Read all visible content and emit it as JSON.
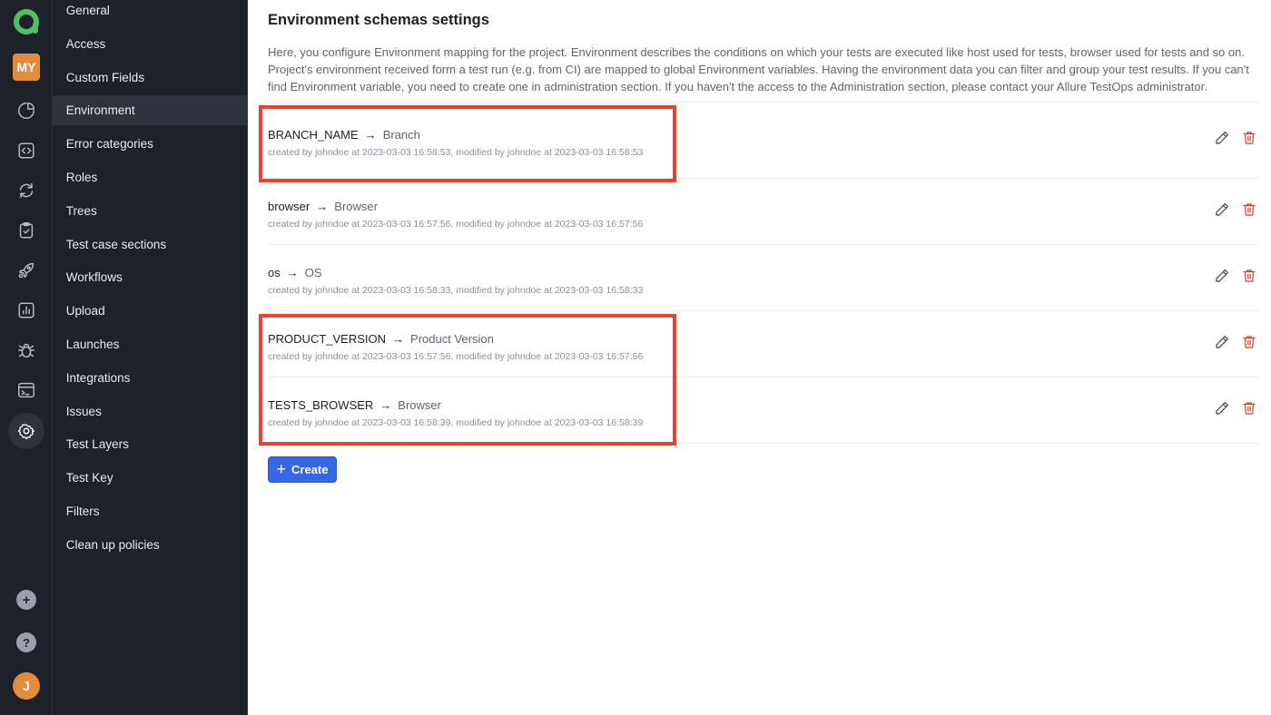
{
  "rail": {
    "project_badge": "MY",
    "avatar_initial": "J",
    "icons": [
      "dashboard-icon",
      "code-icon",
      "sync-icon",
      "clipboard-icon",
      "rocket-icon",
      "chart-icon",
      "bug-icon",
      "terminal-icon",
      "settings-icon"
    ],
    "bottom": {
      "add": "+",
      "help": "?"
    }
  },
  "settings_nav": {
    "items": [
      {
        "label": "General",
        "active": false
      },
      {
        "label": "Access",
        "active": false
      },
      {
        "label": "Custom Fields",
        "active": false
      },
      {
        "label": "Environment",
        "active": true
      },
      {
        "label": "Error categories",
        "active": false
      },
      {
        "label": "Roles",
        "active": false
      },
      {
        "label": "Trees",
        "active": false
      },
      {
        "label": "Test case sections",
        "active": false
      },
      {
        "label": "Workflows",
        "active": false
      },
      {
        "label": "Upload",
        "active": false
      },
      {
        "label": "Launches",
        "active": false
      },
      {
        "label": "Integrations",
        "active": false
      },
      {
        "label": "Issues",
        "active": false
      },
      {
        "label": "Test Layers",
        "active": false
      },
      {
        "label": "Test Key",
        "active": false
      },
      {
        "label": "Filters",
        "active": false
      },
      {
        "label": "Clean up policies",
        "active": false
      }
    ]
  },
  "main": {
    "title": "Environment schemas settings",
    "description": "Here, you configure Environment mapping for the project. Environment describes the conditions on which your tests are executed like host used for tests, browser used for tests and so on. Project's environment received form a test run (e.g. from CI) are mapped to global Environment variables. Having the environment data you can filter and group your test results. If you can't find Environment variable, you need to create one in administration section. If you haven't the access to the Administration section, please contact your Allure TestOps administrator.",
    "arrow": "→",
    "schemas": [
      {
        "key": "BRANCH_NAME",
        "target": "Branch",
        "meta": "created by johndoe at 2023-03-03 16:58:53, modified by johndoe at 2023-03-03 16:58:53"
      },
      {
        "key": "browser",
        "target": "Browser",
        "meta": "created by johndoe at 2023-03-03 16:57:56, modified by johndoe at 2023-03-03 16:57:56"
      },
      {
        "key": "os",
        "target": "OS",
        "meta": "created by johndoe at 2023-03-03 16:58:33, modified by johndoe at 2023-03-03 16:58:33"
      },
      {
        "key": "PRODUCT_VERSION",
        "target": "Product Version",
        "meta": "created by johndoe at 2023-03-03 16:57:56, modified by johndoe at 2023-03-03 16:57:56"
      },
      {
        "key": "TESTS_BROWSER",
        "target": "Browser",
        "meta": "created by johndoe at 2023-03-03 16:58:39, modified by johndoe at 2023-03-03 16:58:39"
      }
    ],
    "create_button": {
      "icon": "+",
      "label": "Create"
    }
  },
  "colors": {
    "sidebar_bg": "#1d2129",
    "accent_blue": "#3568e6",
    "delete_red": "#d53a2c",
    "highlight_red": "#e8432e",
    "project_badge_orange": "#e38d3c",
    "logo_green": "#4fc15f"
  }
}
